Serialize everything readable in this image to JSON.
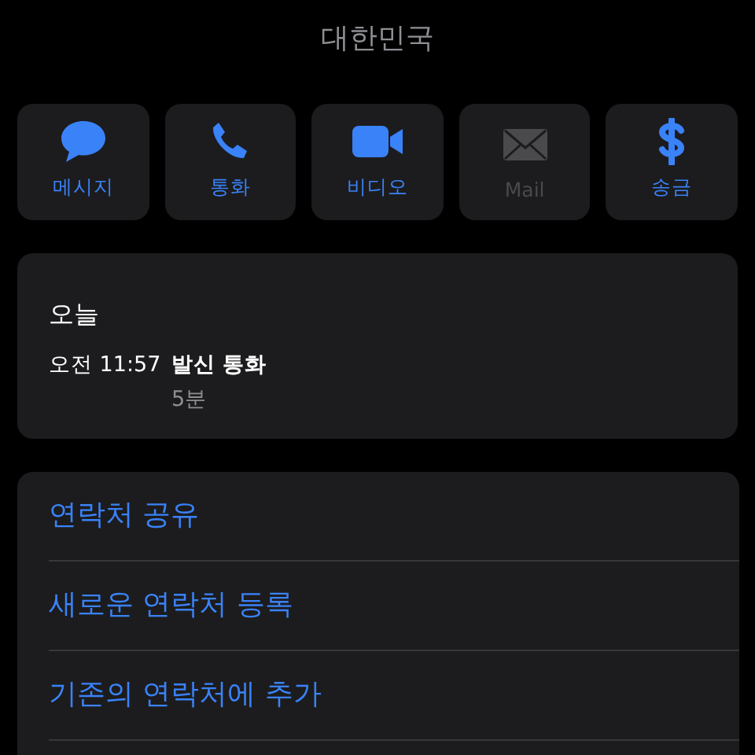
{
  "header": {
    "subtitle": "대한민국"
  },
  "actions": [
    {
      "kind": "message",
      "label": "메시지",
      "disabled": false
    },
    {
      "kind": "phone",
      "label": "통화",
      "disabled": false
    },
    {
      "kind": "video",
      "label": "비디오",
      "disabled": false
    },
    {
      "kind": "mail",
      "label": "Mail",
      "disabled": true
    },
    {
      "kind": "money",
      "label": "송금",
      "disabled": false
    }
  ],
  "call_history": {
    "day": "오늘",
    "entries": [
      {
        "time": "오전 11:57",
        "type": "발신 통화",
        "duration": "5분"
      }
    ]
  },
  "options": [
    "연락처 공유",
    "새로운 연락처 등록",
    "기존의 연락처에 추가"
  ]
}
